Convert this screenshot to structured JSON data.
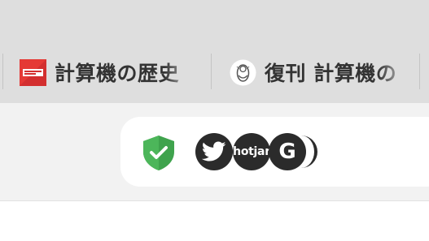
{
  "tabs": [
    {
      "title": "計算機の歴史",
      "favicon": "calculator-museum-favicon",
      "favicon_color": "#d32f2f"
    },
    {
      "title": "復刊 計算機の",
      "favicon": "illustration-favicon"
    }
  ],
  "extensions": [
    {
      "icon": "shield-check-icon",
      "color": "#3fa34d"
    },
    {
      "icon": "twitter-icon"
    },
    {
      "icon": "hotjar-icon",
      "label": "hotjar"
    },
    {
      "icon": "google-icon",
      "label": "G"
    },
    {
      "icon": "extension-icon"
    }
  ]
}
